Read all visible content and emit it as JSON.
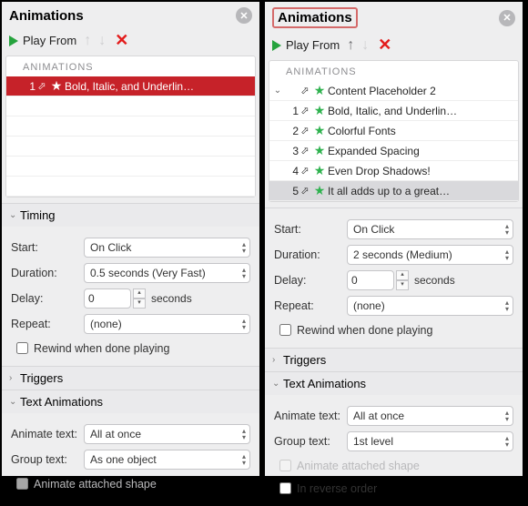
{
  "left": {
    "title": "Animations",
    "play_label": "Play From",
    "list_header": "ANIMATIONS",
    "items": [
      {
        "num": "1",
        "label": "Bold, Italic, and Underlin…"
      }
    ],
    "timing": {
      "header": "Timing",
      "start_label": "Start:",
      "start_value": "On Click",
      "duration_label": "Duration:",
      "duration_value": "0.5 seconds (Very Fast)",
      "delay_label": "Delay:",
      "delay_value": "0",
      "delay_unit": "seconds",
      "repeat_label": "Repeat:",
      "repeat_value": "(none)",
      "rewind_label": "Rewind when done playing"
    },
    "triggers_header": "Triggers",
    "text_anim": {
      "header": "Text Animations",
      "animate_label": "Animate text:",
      "animate_value": "All at once",
      "group_label": "Group text:",
      "group_value": "As one object",
      "attached_label": "Animate attached shape"
    }
  },
  "right": {
    "title": "Animations",
    "play_label": "Play From",
    "list_header": "ANIMATIONS",
    "parent_label": "Content Placeholder 2",
    "items": [
      {
        "num": "1",
        "label": "Bold, Italic, and Underlin…"
      },
      {
        "num": "2",
        "label": "Colorful Fonts"
      },
      {
        "num": "3",
        "label": "Expanded Spacing"
      },
      {
        "num": "4",
        "label": "Even Drop Shadows!"
      },
      {
        "num": "5",
        "label": "It all adds up to a great…"
      }
    ],
    "start_label": "Start:",
    "start_value": "On Click",
    "duration_label": "Duration:",
    "duration_value": "2 seconds (Medium)",
    "delay_label": "Delay:",
    "delay_value": "0",
    "delay_unit": "seconds",
    "repeat_label": "Repeat:",
    "repeat_value": "(none)",
    "rewind_label": "Rewind when done playing",
    "triggers_header": "Triggers",
    "text_anim": {
      "header": "Text Animations",
      "animate_label": "Animate text:",
      "animate_value": "All at once",
      "group_label": "Group text:",
      "group_value": "1st level",
      "attached_label": "Animate attached shape",
      "reverse_label": "In reverse order"
    }
  }
}
